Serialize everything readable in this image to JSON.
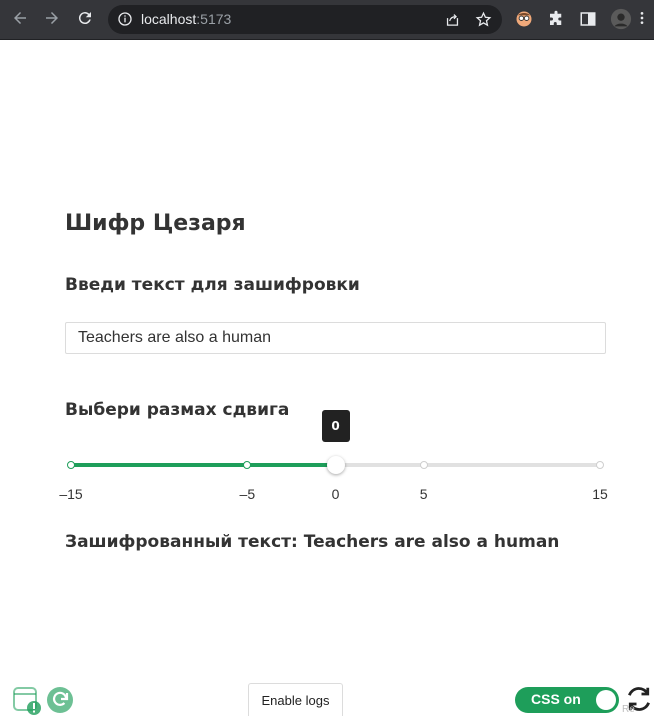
{
  "browser": {
    "url_host": "localhost",
    "url_port": ":5173"
  },
  "page": {
    "title": "Шифр Цезаря",
    "input_section_label": "Введи текст для зашифровки",
    "input_value": "Teachers are also a human",
    "shift_label": "Выбери размах сдвига",
    "slider": {
      "min": -15,
      "max": 15,
      "value": 0,
      "marks": [
        "-15",
        "-5",
        "0",
        "5",
        "15"
      ],
      "tooltip": "0"
    },
    "result_prefix": "Зашифрованный текст: ",
    "result_value": "Teachers are also a human"
  },
  "footer": {
    "logs_button": "Enable logs",
    "css_toggle_label": "CSS on",
    "faint_label": "Re"
  },
  "colors": {
    "accent": "#1e9e5a",
    "chrome_bg": "#35363a"
  }
}
